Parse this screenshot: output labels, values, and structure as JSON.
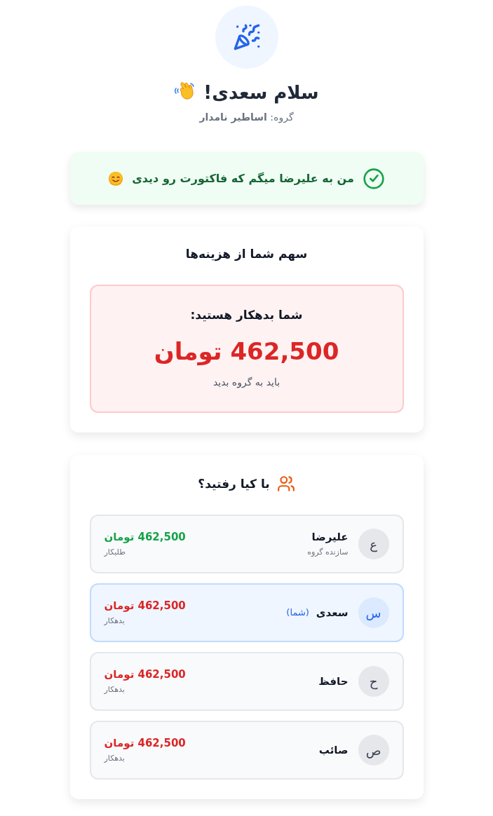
{
  "header": {
    "greeting": "سلام سعدی!",
    "group_line": "گروه: **اساطیر نامدار**"
  },
  "notice": {
    "text": "من به علیرضا میگم که فاکتورت رو دیدی"
  },
  "share_card": {
    "title": "سهم شما از هزینه‌ها",
    "balance": {
      "kind": "debtor",
      "label": "شما بدهکار هستید:",
      "amount": "462,500 تومان",
      "note": "باید به گروه بدید"
    }
  },
  "members_card": {
    "title": "با کیا رفتید؟",
    "members": [
      {
        "initial": "ع",
        "name": "علیرضا",
        "role": "سازنده گروه",
        "amount": "462,500 تومان",
        "status": "طلبکار",
        "kind": "creditor",
        "current": false
      },
      {
        "initial": "س",
        "name": "سعدی",
        "you_tag": "(شما)",
        "amount": "462,500 تومان",
        "status": "بدهکار",
        "kind": "debtor",
        "current": true
      },
      {
        "initial": "ح",
        "name": "حافظ",
        "amount": "462,500 تومان",
        "status": "بدهکار",
        "kind": "debtor",
        "current": false
      },
      {
        "initial": "ص",
        "name": "صائب",
        "amount": "462,500 تومان",
        "status": "بدهکار",
        "kind": "debtor",
        "current": false
      }
    ]
  }
}
